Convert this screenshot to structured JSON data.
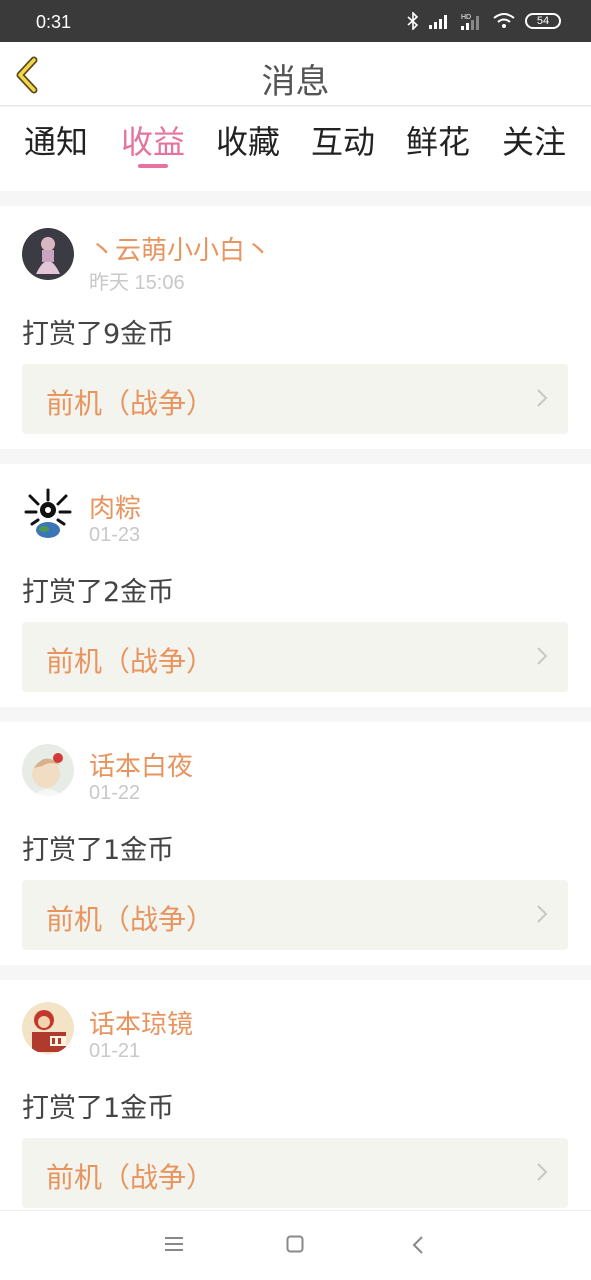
{
  "status_bar": {
    "time": "0:31",
    "battery": "54"
  },
  "header": {
    "title": "消息"
  },
  "tabs": [
    {
      "label": "通知",
      "active": false
    },
    {
      "label": "收益",
      "active": true
    },
    {
      "label": "收藏",
      "active": false
    },
    {
      "label": "互动",
      "active": false
    },
    {
      "label": "鲜花",
      "active": false
    },
    {
      "label": "关注",
      "active": false
    }
  ],
  "messages": [
    {
      "user": "丶云萌小小白丶",
      "time": "昨天 15:06",
      "action": "打赏了9金币",
      "work": "前机（战争）",
      "avatar": "avatar-girl-icon"
    },
    {
      "user": "肉粽",
      "time": "01-23",
      "action": "打赏了2金币",
      "work": "前机（战争）",
      "avatar": "avatar-planet-icon"
    },
    {
      "user": "话本白夜",
      "time": "01-22",
      "action": "打赏了1金币",
      "work": "前机（战争）",
      "avatar": "avatar-flower-icon"
    },
    {
      "user": "话本琼镜",
      "time": "01-21",
      "action": "打赏了1金币",
      "work": "前机（战争）",
      "avatar": "avatar-cartoon-icon"
    }
  ],
  "colors": {
    "accent": "#e6739f",
    "username": "#e8945f",
    "link_bg": "#f4f4ee"
  }
}
